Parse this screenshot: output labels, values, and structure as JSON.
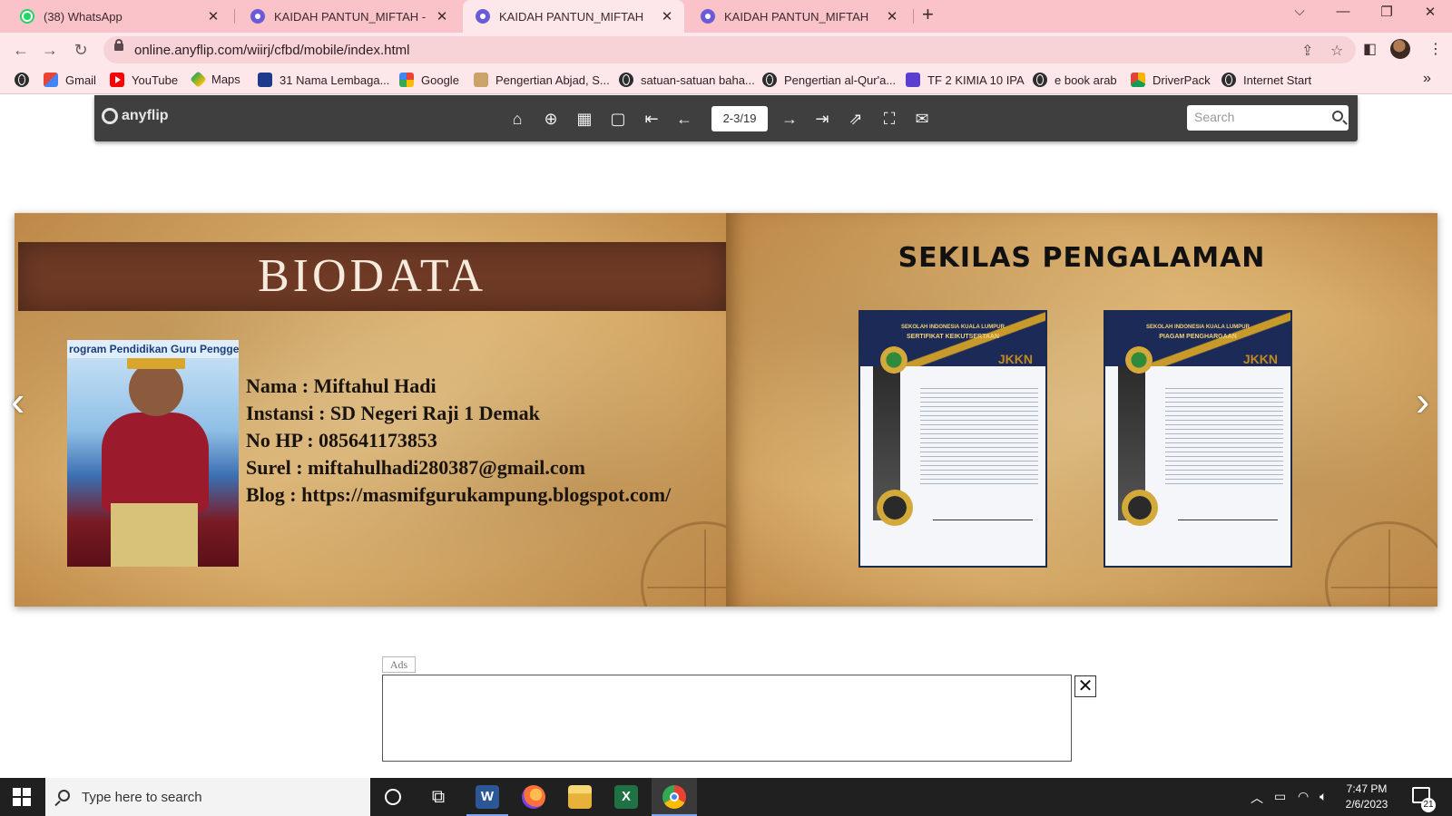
{
  "browser": {
    "tabs": [
      {
        "label": "(38) WhatsApp",
        "favicon": "whatsapp-icon",
        "active": false
      },
      {
        "label": "KAIDAH PANTUN_MIFTAH - Mift",
        "favicon": "anyflip-icon",
        "active": false
      },
      {
        "label": "KAIDAH PANTUN_MIFTAH",
        "favicon": "anyflip-icon",
        "active": true
      },
      {
        "label": "KAIDAH PANTUN_MIFTAH",
        "favicon": "anyflip-icon",
        "active": false
      }
    ],
    "url": "online.anyflip.com/wiirj/cfbd/mobile/index.html",
    "bookmarks": [
      {
        "label": "",
        "icon": "globe-icon"
      },
      {
        "label": "Gmail",
        "icon": "gmail-icon"
      },
      {
        "label": "YouTube",
        "icon": "youtube-icon"
      },
      {
        "label": "Maps",
        "icon": "maps-icon"
      },
      {
        "label": "31 Nama Lembaga...",
        "icon": "bookmark-icon"
      },
      {
        "label": "Google",
        "icon": "google-icon"
      },
      {
        "label": "Pengertian Abjad, S...",
        "icon": "bookmark-icon"
      },
      {
        "label": "satuan-satuan baha...",
        "icon": "globe-icon"
      },
      {
        "label": "Pengertian al-Qur'a...",
        "icon": "globe-icon"
      },
      {
        "label": "TF 2 KIMIA 10 IPA",
        "icon": "form-icon"
      },
      {
        "label": "e book arab",
        "icon": "globe-icon"
      },
      {
        "label": "DriverPack",
        "icon": "driverpack-icon"
      },
      {
        "label": "Internet Start",
        "icon": "globe-icon"
      }
    ],
    "bookmarks_more": "»"
  },
  "viewer": {
    "logo": "anyflip",
    "page_indicator": "2-3/19",
    "search_placeholder": "Search"
  },
  "book": {
    "left": {
      "title": "BIODATA",
      "photo_banner": "rogram Pendidikan Guru Penggerak",
      "lines": [
        "Nama : Miftahul Hadi",
        "Instansi : SD Negeri Raji 1 Demak",
        "No HP : 085641173853",
        "Surel : miftahulhadi280387@gmail.com",
        "Blog : https://masmifgurukampung.blogspot.com/"
      ]
    },
    "right": {
      "title": "SEKILAS PENGALAMAN",
      "certificates": [
        {
          "header": "SEKOLAH INDONESIA KUALA LUMPUR",
          "title": "SERTIFIKAT KEIKUTSERTAAN",
          "badge": "JKKN"
        },
        {
          "header": "SEKOLAH INDONESIA KUALA LUMPUR",
          "title": "PIAGAM PENGHARGAAN",
          "badge": "JKKN"
        }
      ]
    }
  },
  "ads": {
    "label": "Ads",
    "close": "✕"
  },
  "taskbar": {
    "search_placeholder": "Type here to search",
    "time": "7:47 PM",
    "date": "2/6/2023",
    "notification_count": "21"
  }
}
